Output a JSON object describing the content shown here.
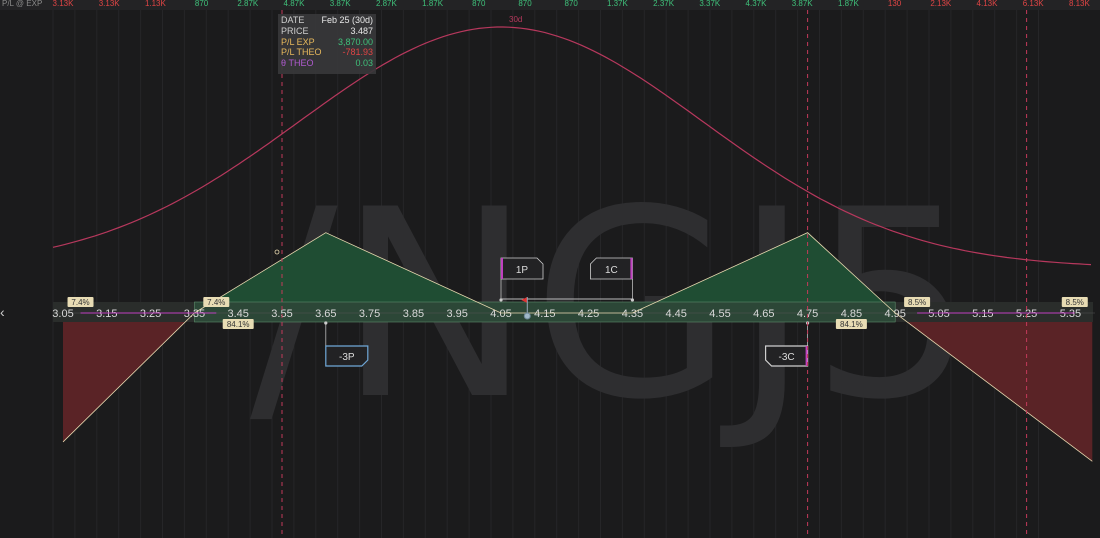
{
  "watermark": "/NGJ5",
  "top_bar": {
    "label": "P/L @ EXP",
    "values": [
      "3.13K",
      "3.13K",
      "1.13K",
      "870",
      "2.87K",
      "4.87K",
      "3.87K",
      "2.87K",
      "1.87K",
      "870",
      "870",
      "870",
      "1.37K",
      "2.37K",
      "3.37K",
      "4.37K",
      "3.87K",
      "1.87K",
      "130",
      "2.13K",
      "4.13K",
      "6.13K",
      "8.13K"
    ],
    "colors": [
      "#e04545",
      "#e04545",
      "#e04545",
      "#3fc07a",
      "#3fc07a",
      "#3fc07a",
      "#3fc07a",
      "#3fc07a",
      "#3fc07a",
      "#3fc07a",
      "#3fc07a",
      "#3fc07a",
      "#3fc07a",
      "#3fc07a",
      "#3fc07a",
      "#3fc07a",
      "#3fc07a",
      "#3fc07a",
      "#e04545",
      "#e04545",
      "#e04545",
      "#e04545",
      "#e04545"
    ]
  },
  "tooltip": {
    "rows": [
      {
        "label": "DATE",
        "value": "Feb 25 (30d)",
        "label_color": "#cfcfcf",
        "value_color": "#e8e8e8"
      },
      {
        "label": "PRICE",
        "value": "3.487",
        "label_color": "#cfcfcf",
        "value_color": "#e8e8e8"
      },
      {
        "label": "P/L EXP",
        "value": "3,870.00",
        "label_color": "#e6b85c",
        "value_color": "#3fc07a"
      },
      {
        "label": "P/L THEO",
        "value": "-781.93",
        "label_color": "#e6b85c",
        "value_color": "#e04545"
      },
      {
        "label": "θ THEO",
        "value": "0.03",
        "label_color": "#b05ad0",
        "value_color": "#3fc07a"
      }
    ]
  },
  "theo_label": "30d",
  "legs": [
    {
      "label": "1P",
      "price": 4.05,
      "side": "above"
    },
    {
      "label": "1C",
      "price": 4.35,
      "side": "above"
    },
    {
      "label": "-3P",
      "price": 3.65,
      "side": "below"
    },
    {
      "label": "-3C",
      "price": 4.75,
      "side": "below"
    }
  ],
  "prob_labels": [
    {
      "text": "7.4%",
      "price": 3.09,
      "row": "above"
    },
    {
      "text": "7.4%",
      "price": 3.4,
      "row": "above"
    },
    {
      "text": "84.1%",
      "price": 3.45,
      "row": "below"
    },
    {
      "text": "84.1%",
      "price": 4.85,
      "row": "below"
    },
    {
      "text": "8.5%",
      "price": 5.0,
      "row": "above"
    },
    {
      "text": "8.5%",
      "price": 5.36,
      "row": "above"
    }
  ],
  "chart_data": {
    "type": "line",
    "x_ticks": [
      "3.05",
      "3.15",
      "3.25",
      "3.35",
      "3.45",
      "3.55",
      "3.65",
      "3.75",
      "3.85",
      "3.95",
      "4.05",
      "4.15",
      "4.25",
      "4.35",
      "4.45",
      "4.55",
      "4.65",
      "4.75",
      "4.85",
      "4.95",
      "5.05",
      "5.15",
      "5.25",
      "5.35"
    ],
    "current_price": 4.11,
    "expiration_pl": {
      "x": [
        3.05,
        3.35,
        3.65,
        4.05,
        4.35,
        4.75,
        4.95,
        5.4
      ],
      "y": [
        -3130,
        0,
        1950,
        0,
        0,
        1950,
        0,
        -3600
      ]
    },
    "theo_curve_peak_price": 4.05,
    "expiry_markers": [
      3.55,
      4.75,
      5.25
    ],
    "colors": {
      "profit": "#1f4d33",
      "loss": "#5a2326",
      "theo_line": "#b7385d",
      "pl_line": "#e8d9b0",
      "axis_band": "#2c4a38",
      "marker": "#c23a5a",
      "current": "#e03030"
    }
  },
  "nav": {
    "back_symbol": "‹"
  }
}
